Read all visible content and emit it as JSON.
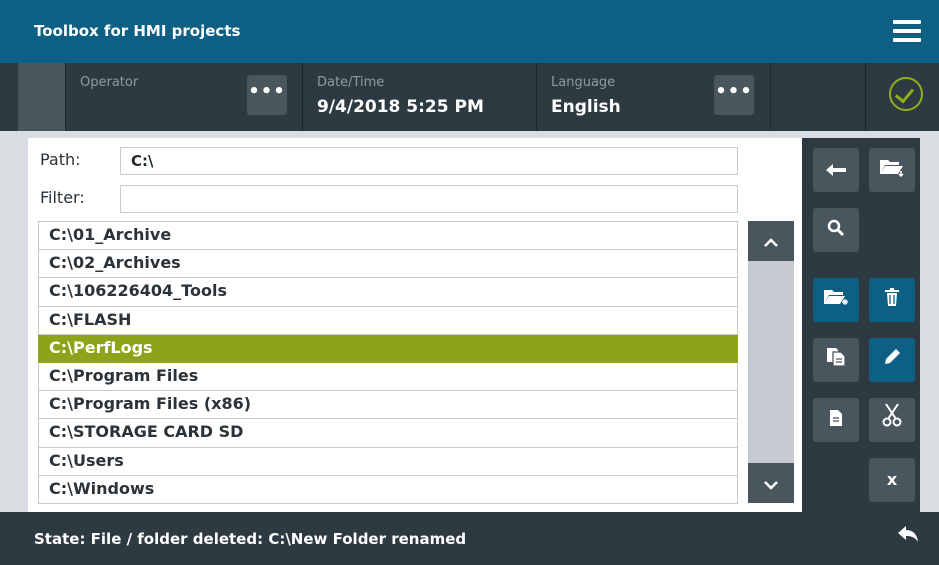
{
  "app": {
    "title": "Toolbox for HMI projects"
  },
  "header": {
    "operator_label": "Operator",
    "datetime_label": "Date/Time",
    "datetime_value": "9/4/2018 5:25 PM",
    "language_label": "Language",
    "language_value": "English",
    "dots": "•••"
  },
  "path": {
    "label": "Path:",
    "value": "C:\\"
  },
  "filter": {
    "label": "Filter:",
    "value": ""
  },
  "files": [
    "C:\\01_Archive",
    "C:\\02_Archives",
    "C:\\106226404_Tools",
    "C:\\FLASH",
    "C:\\PerfLogs",
    "C:\\Program Files",
    "C:\\Program Files (x86)",
    "C:\\STORAGE CARD SD",
    "C:\\Users",
    "C:\\Windows"
  ],
  "selected_file": "C:\\PerfLogs",
  "scroll": {
    "up": "⌃",
    "down": "⌄"
  },
  "tools": {
    "close_label": "x"
  },
  "status": {
    "message": "State: File / folder deleted: C:\\New Folder renamed"
  },
  "colors": {
    "title_bar": "#0e5f84",
    "header": "#2e3a42",
    "accent_green": "#8fa31a",
    "tool_blue": "#0e5f84",
    "tool_gray": "#4a565e"
  },
  "icons": [
    "menu-icon",
    "dots-icon",
    "checkmark-circle-icon",
    "back-arrow-icon",
    "folder-import-icon",
    "search-icon",
    "new-folder-icon",
    "delete-icon",
    "copy-icon",
    "rename-icon",
    "paste-icon",
    "cut-icon",
    "close-icon",
    "return-icon"
  ]
}
